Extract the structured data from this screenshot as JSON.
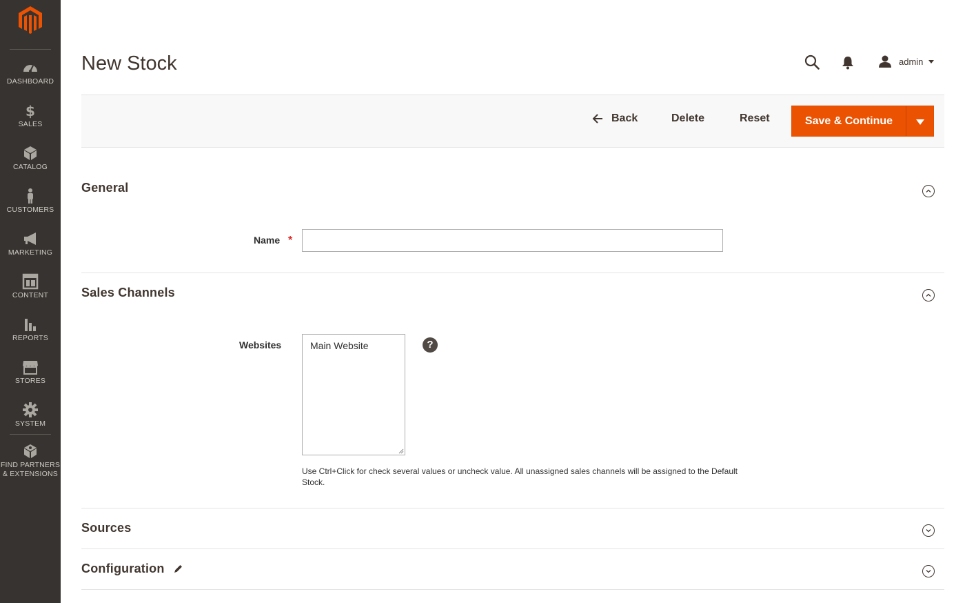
{
  "sidebar": {
    "items": [
      {
        "label": "DASHBOARD",
        "icon": "dashboard-icon"
      },
      {
        "label": "SALES",
        "icon": "dollar-icon"
      },
      {
        "label": "CATALOG",
        "icon": "box-icon"
      },
      {
        "label": "CUSTOMERS",
        "icon": "person-icon"
      },
      {
        "label": "MARKETING",
        "icon": "megaphone-icon"
      },
      {
        "label": "CONTENT",
        "icon": "layout-icon"
      },
      {
        "label": "REPORTS",
        "icon": "bar-chart-icon"
      },
      {
        "label": "STORES",
        "icon": "storefront-icon"
      },
      {
        "label": "SYSTEM",
        "icon": "gear-icon"
      },
      {
        "label_line1": "FIND PARTNERS",
        "label_line2": "& EXTENSIONS",
        "icon": "extensions-icon"
      }
    ]
  },
  "header": {
    "title": "New Stock",
    "user": "admin"
  },
  "actions": {
    "back": "Back",
    "delete": "Delete",
    "reset": "Reset",
    "save": "Save & Continue"
  },
  "sections": {
    "general": {
      "title": "General",
      "name_label": "Name",
      "name_value": ""
    },
    "sales_channels": {
      "title": "Sales Channels",
      "websites_label": "Websites",
      "websites_options": [
        "Main Website"
      ],
      "note": "Use Ctrl+Click for check several values or uncheck value. All unassigned sales channels will be assigned to the Default Stock."
    },
    "sources": {
      "title": "Sources"
    },
    "configuration": {
      "title": "Configuration"
    }
  },
  "colors": {
    "sidebar_bg": "#373330",
    "accent": "#eb5202"
  }
}
